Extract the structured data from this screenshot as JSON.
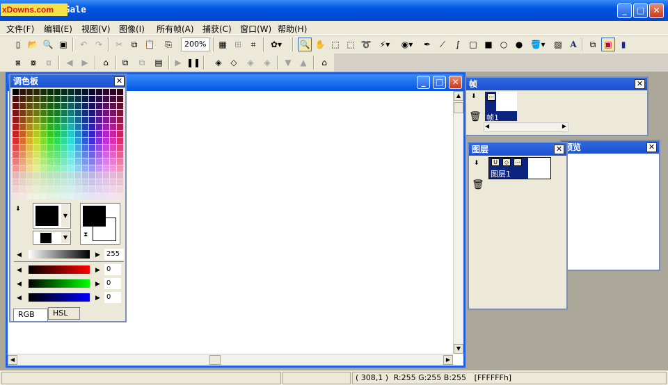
{
  "window": {
    "title": "GraphicsGale",
    "watermark": "xDowns.com",
    "buttons": {
      "minimize": "_",
      "maximize": "□",
      "close": "✕"
    }
  },
  "menu": [
    "文件(F)",
    "编辑(E)",
    "视图(V)",
    "图像(I)",
    "所有帧(A)",
    "捕获(C)",
    "窗口(W)",
    "帮助(H)"
  ],
  "toolbar": {
    "zoom": "200%"
  },
  "palette": {
    "title": "调色板",
    "slider_value": "255",
    "red": "0",
    "green": "0",
    "blue": "0",
    "tabs": [
      "RGB",
      "HSL"
    ],
    "colors": {
      "red": "#ff0000",
      "green": "#00ff00",
      "blue": "#0000ff"
    }
  },
  "frames": {
    "title": "帧",
    "item": "帧1"
  },
  "layers": {
    "title": "图层",
    "item": "图层1"
  },
  "preview": {
    "title": "预览"
  },
  "status": {
    "coord": "( 308,1 )",
    "rgb": "R:255 G:255 B:255",
    "hex": "[FFFFFFh]"
  }
}
